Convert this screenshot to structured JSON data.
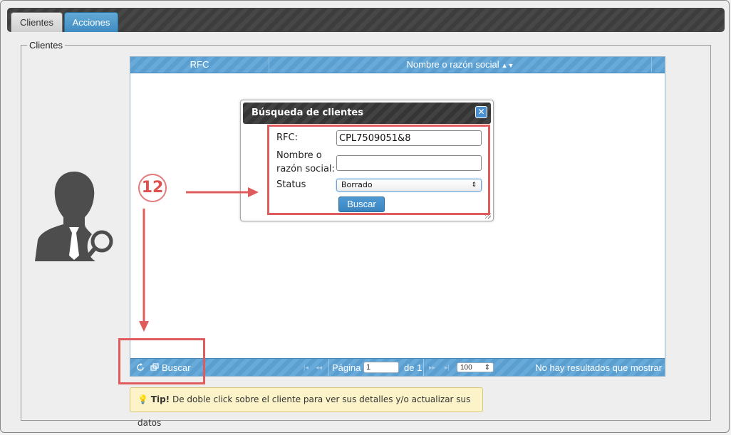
{
  "tabs": [
    {
      "label": "Clientes"
    },
    {
      "label": "Acciones"
    }
  ],
  "fieldset_legend": "Clientes",
  "grid": {
    "columns": [
      {
        "label": "RFC"
      },
      {
        "label": "Nombre o razón social",
        "sort": "▲▼"
      }
    ],
    "footer": {
      "search_label": "Buscar",
      "page_label": "Página",
      "page_value": "1",
      "of_label": "de 1",
      "page_size": "100",
      "status": "No hay resultados que mostrar"
    }
  },
  "dialog": {
    "title": "Búsqueda de clientes",
    "fields": {
      "rfc_label": "RFC:",
      "rfc_value": "CPL7509051&8",
      "name_label_1": "Nombre o",
      "name_label_2": "razón social:",
      "name_value": "",
      "status_label": "Status",
      "status_value": "Borrado"
    },
    "button": "Buscar"
  },
  "annotation": {
    "step": "12"
  },
  "tip": {
    "prefix": "Tip!",
    "text": " De doble click sobre el cliente para ver sus detalles y/o actualizar sus datos"
  },
  "colors": {
    "accent": "#4a90c8",
    "annotation": "#e05b5b",
    "tip_bg": "#fcf3c9"
  }
}
